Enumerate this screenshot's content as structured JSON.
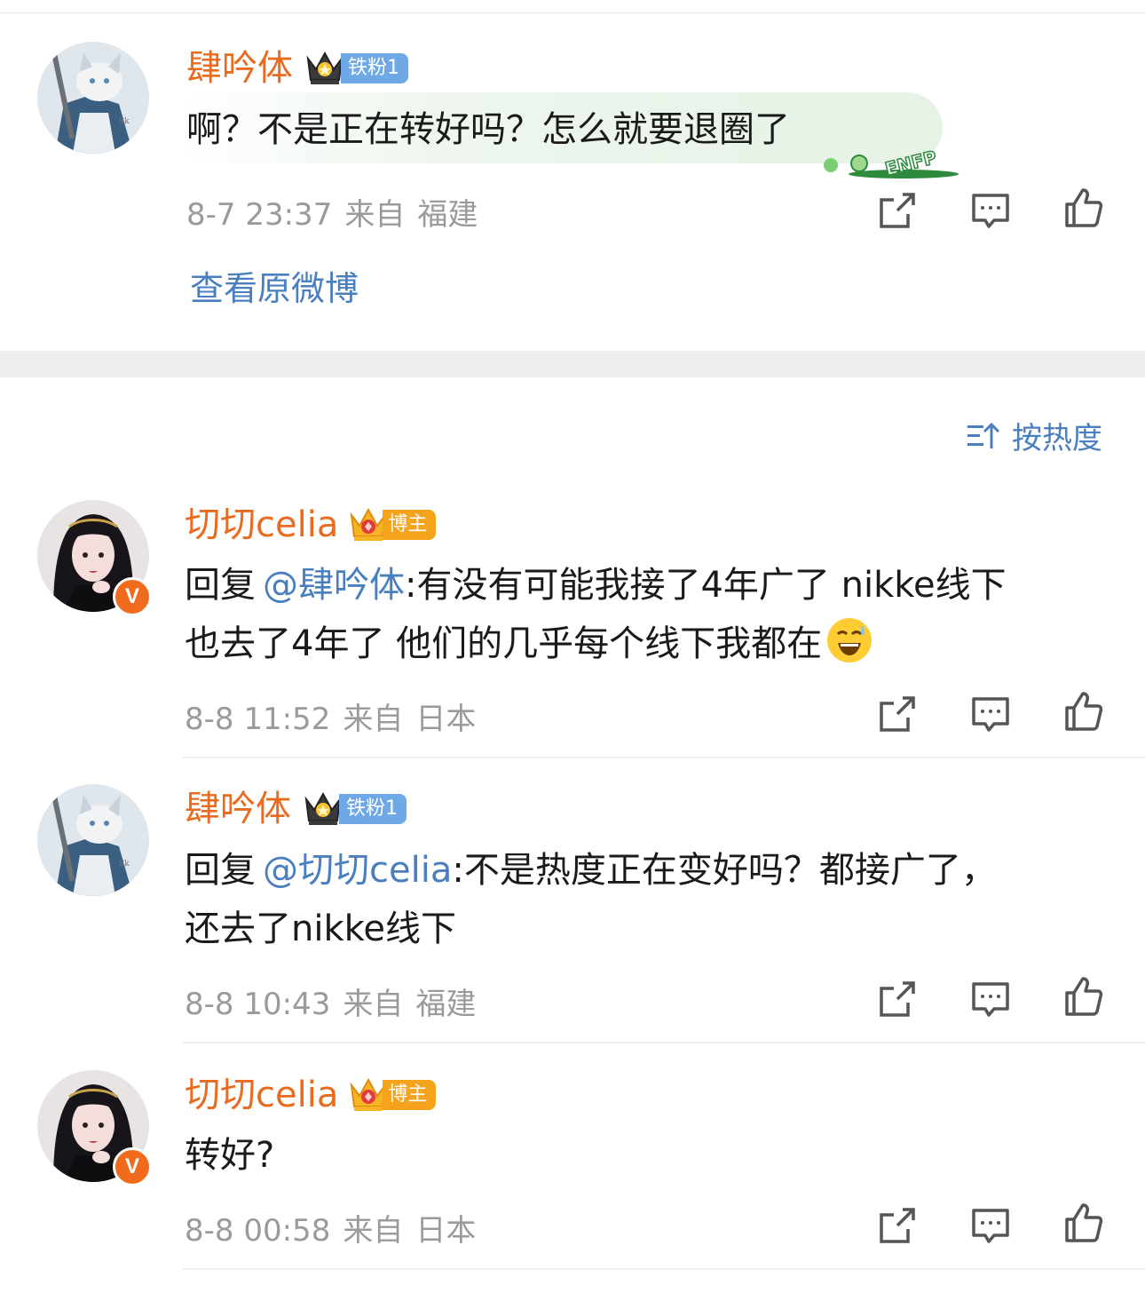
{
  "badges": {
    "fan": "铁粉1",
    "host": "博主"
  },
  "comments": [
    {
      "user": "肆吟体",
      "text": "啊？不是正在转好吗？怎么就要退圈了",
      "time": "8-7 23:37",
      "from": "来自",
      "location": "福建",
      "sticker": "ENFP",
      "view_original": "查看原微博"
    },
    {
      "user": "切切celia",
      "reply_prefix": "回复",
      "mention": "@肆吟体",
      "text_line1": ":有没有可能我接了4年广了 nikke线下",
      "text_line2": "也去了4年了 他们的几乎每个线下我都在",
      "time": "8-8 11:52",
      "from": "来自",
      "location": "日本",
      "verified": "V"
    },
    {
      "user": "肆吟体",
      "reply_prefix": "回复",
      "mention": "@切切celia",
      "text_line1": ":不是热度正在变好吗？都接广了，",
      "text_line2": "还去了nikke线下",
      "time": "8-8 10:43",
      "from": "来自",
      "location": "福建"
    },
    {
      "user": "切切celia",
      "text": "转好?",
      "time": "8-8 00:58",
      "from": "来自",
      "location": "日本",
      "verified": "V"
    }
  ],
  "sort": {
    "label": "按热度",
    "icon": "sort-icon"
  },
  "icons": [
    "share-icon",
    "comment-icon",
    "like-icon",
    "crown-icon"
  ],
  "colors": {
    "username": "#e86b1f",
    "link": "#4a7fbf",
    "meta": "#9a9a9a",
    "fan_badge": "#6fa8e6",
    "host_badge": "#f5a21c",
    "verified": "#f26a1b"
  }
}
